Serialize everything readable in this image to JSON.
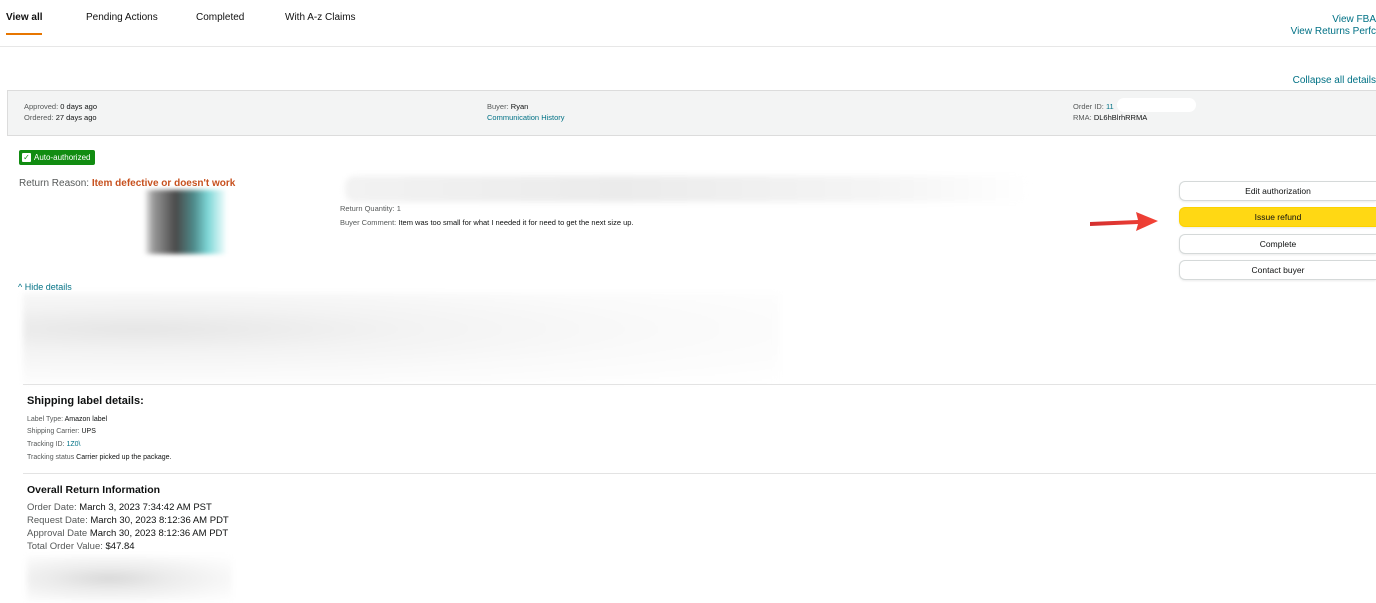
{
  "tabs": [
    {
      "label": "View all",
      "active": true
    },
    {
      "label": "Pending Actions",
      "active": false
    },
    {
      "label": "Completed",
      "active": false
    },
    {
      "label": "With A-z Claims",
      "active": false
    }
  ],
  "top_links": {
    "view_fba": "View FBA",
    "view_returns_perf": "View Returns Perfc"
  },
  "collapse_all": "Collapse all details",
  "header": {
    "approved_label": "Approved:",
    "approved_value": "0 days ago",
    "ordered_label": "Ordered:",
    "ordered_value": "27 days ago",
    "buyer_label": "Buyer:",
    "buyer_value": "Ryan",
    "communication_history": "Communication History",
    "order_id_label": "Order ID:",
    "order_id_value": "11",
    "rma_label": "RMA:",
    "rma_value": "DL6hBlrhRRMA"
  },
  "badge": {
    "label": "Auto-authorized",
    "color": "#118c11"
  },
  "return_reason": {
    "label": "Return Reason:",
    "value": "Item defective or doesn't work"
  },
  "item": {
    "return_quantity": "Return Quantity: 1",
    "buyer_comment_label": "Buyer Comment:",
    "buyer_comment_value": "Item was too small for what I needed it for need to get the next size up."
  },
  "actions": {
    "edit": "Edit authorization",
    "issue_refund": "Issue refund",
    "complete": "Complete",
    "contact": "Contact buyer"
  },
  "hide_details": "^ Hide details",
  "shipping": {
    "title": "Shipping label details:",
    "label_type_label": "Label Type:",
    "label_type_value": "Amazon label",
    "carrier_label": "Shipping Carrier:",
    "carrier_value": "UPS",
    "tracking_label": "Tracking ID:",
    "tracking_value": "1Z0\\",
    "status_label": "Tracking status",
    "status_value": "Carrier picked up the package."
  },
  "overall": {
    "title": "Overall Return Information",
    "order_date_label": "Order Date:",
    "order_date_value": "March 3, 2023 7:34:42 AM PST",
    "request_date_label": "Request Date:",
    "request_date_value": "March 30, 2023 8:12:36 AM PDT",
    "approval_date_label": "Approval Date",
    "approval_date_value": "March 30, 2023 8:12:36 AM PDT",
    "total_label": "Total Order Value:",
    "total_value": "$47.84"
  },
  "colors": {
    "accent_orange": "#e77600",
    "link": "#007185",
    "refund_yellow": "#ffd814",
    "arrow_red": "#e53935"
  }
}
